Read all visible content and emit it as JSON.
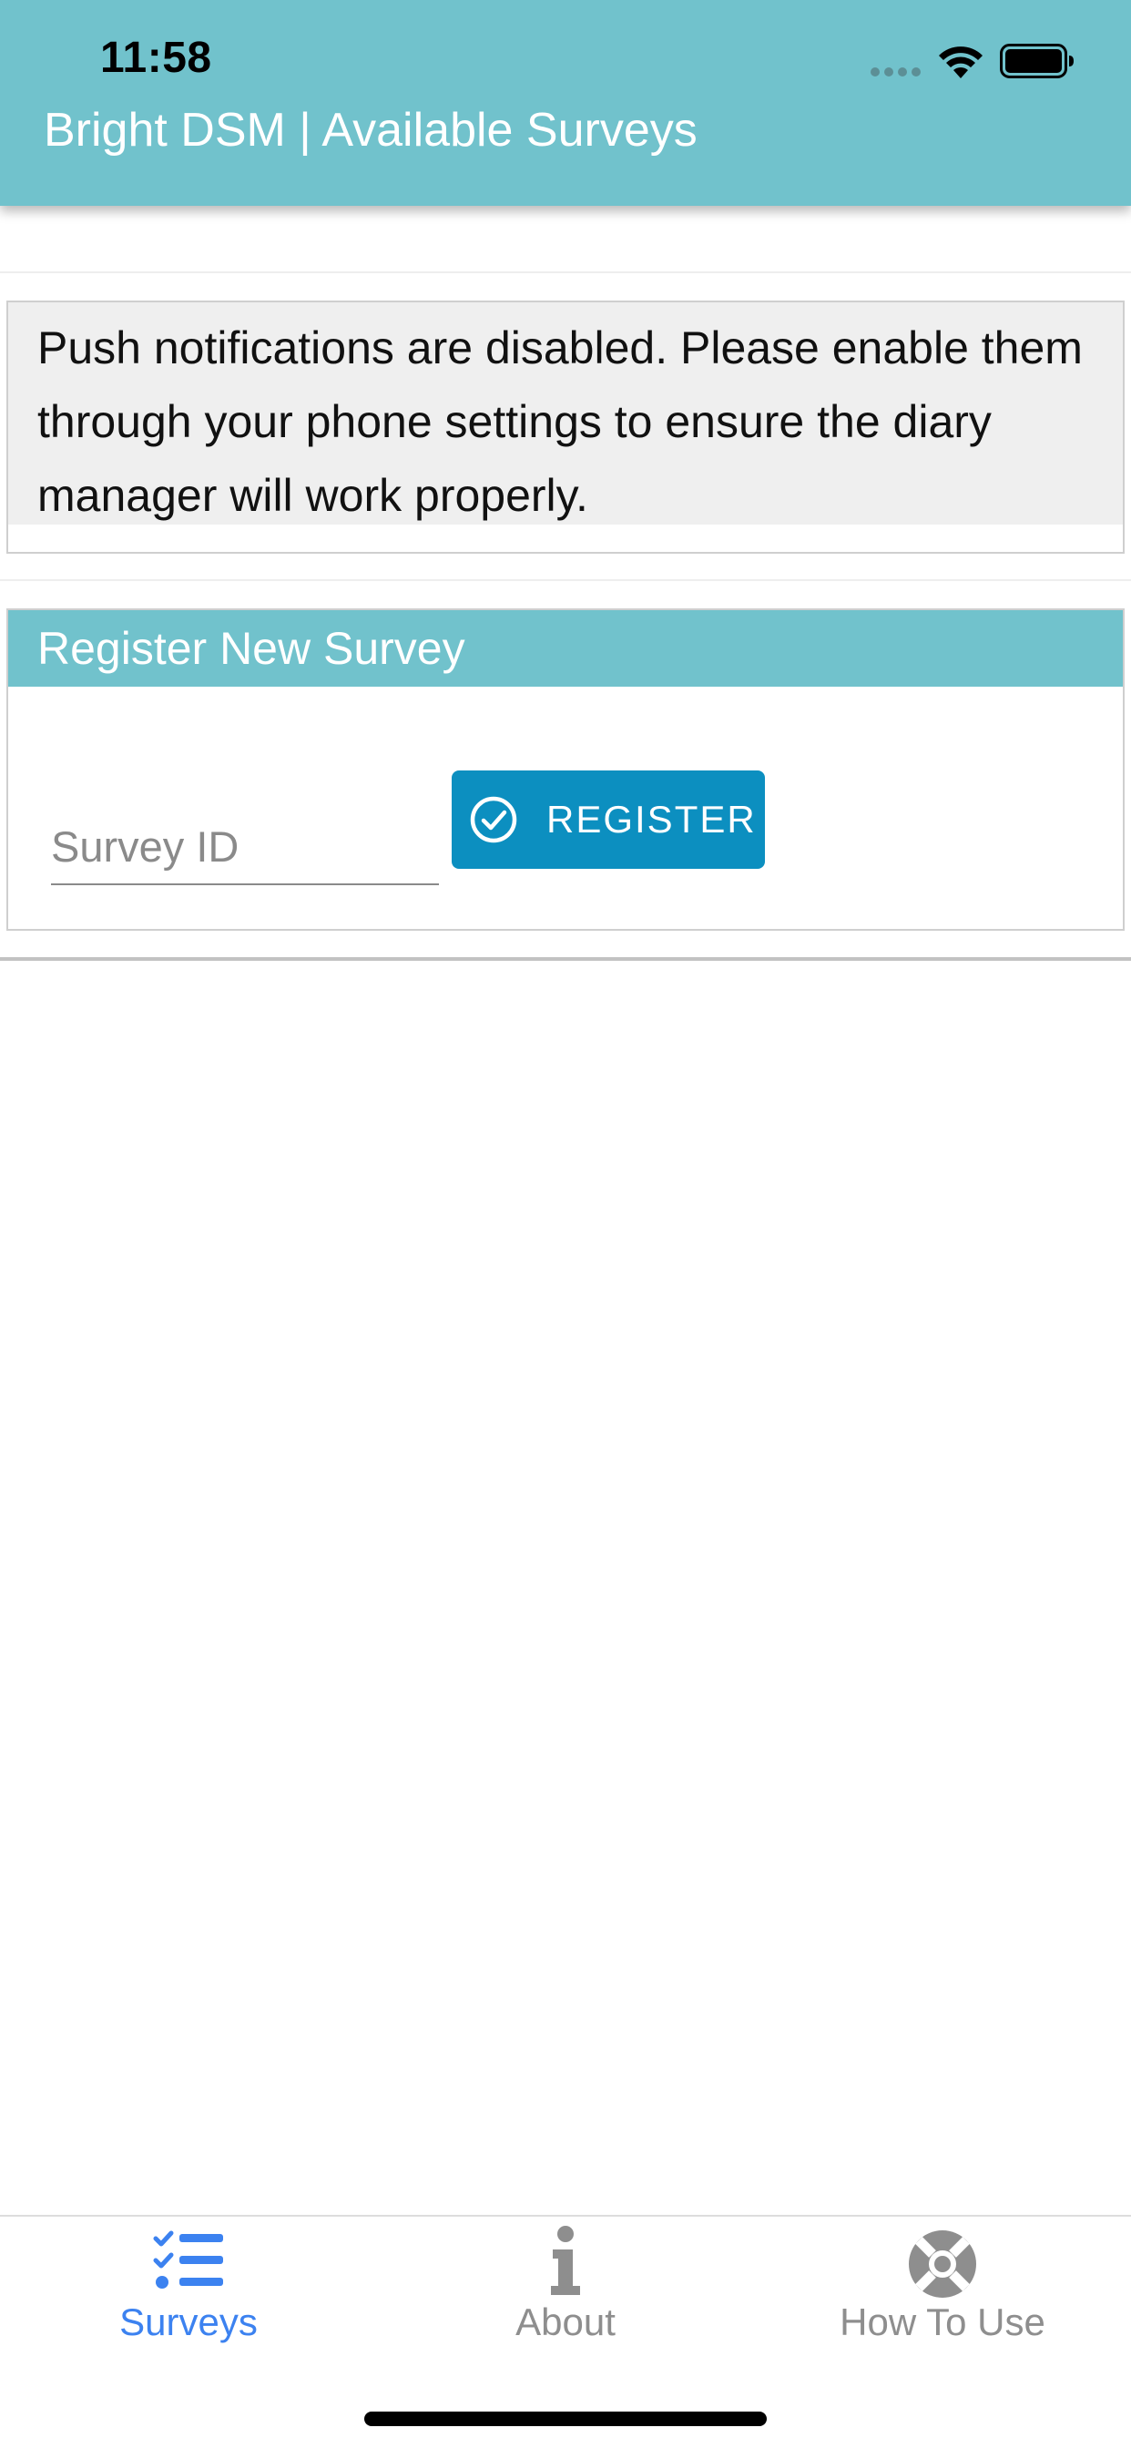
{
  "status_bar": {
    "time": "11:58"
  },
  "header": {
    "title": "Bright DSM | Available Surveys"
  },
  "notice": {
    "text": "Push notifications are disabled. Please enable them through your phone settings to ensure the diary manager will work properly."
  },
  "register": {
    "title": "Register New Survey",
    "input_placeholder": "Survey ID",
    "input_value": "",
    "button_label": "REGISTER",
    "button_color": "#0c8fc0"
  },
  "colors": {
    "brand": "#71c2cc",
    "tab_active": "#3c82f0",
    "tab_inactive": "#8e8e8e"
  },
  "tabs": [
    {
      "label": "Surveys",
      "icon": "list-check-icon",
      "active": true
    },
    {
      "label": "About",
      "icon": "info-icon",
      "active": false
    },
    {
      "label": "How To Use",
      "icon": "lifebuoy-icon",
      "active": false
    }
  ]
}
